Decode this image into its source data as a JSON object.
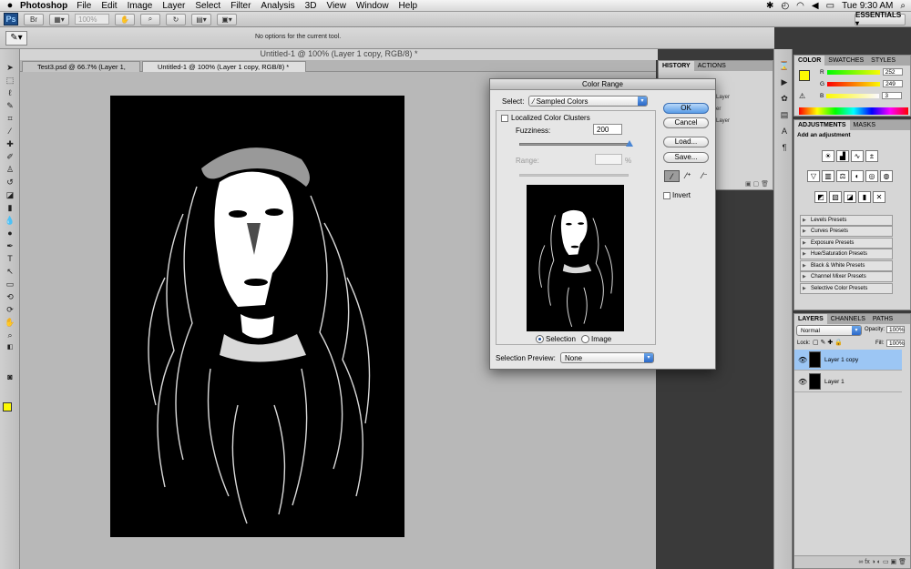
{
  "menubar": {
    "apple": "",
    "app": "Photoshop",
    "items": [
      "File",
      "Edit",
      "Image",
      "Layer",
      "Select",
      "Filter",
      "Analysis",
      "3D",
      "View",
      "Window",
      "Help"
    ],
    "clock": "Tue 9:30 AM"
  },
  "appbar": {
    "ps": "Ps",
    "zoom": "100%",
    "workspace": "ESSENTIALS ▾"
  },
  "options": {
    "message": "No options for the current tool."
  },
  "document": {
    "window_title": "Untitled-1 @ 100% (Layer 1 copy, RGB/8) *",
    "tabs": [
      {
        "label": "Test3.psd @ 66.7% (Layer 1, RGB/8) *"
      },
      {
        "label": "Untitled-1 @ 100% (Layer 1 copy, RGB/8) *"
      }
    ]
  },
  "history": {
    "tabs": [
      "HISTORY",
      "ACTIONS"
    ],
    "items": [
      "",
      "",
      "Layer",
      "er",
      "Layer",
      ""
    ]
  },
  "color_panel": {
    "tabs": [
      "COLOR",
      "SWATCHES",
      "STYLES"
    ],
    "r_label": "R",
    "g_label": "G",
    "b_label": "B",
    "r": "252",
    "g": "249",
    "b": "3",
    "fg": "#fcf903",
    "bg": "#ff9999"
  },
  "adjustments": {
    "tabs": [
      "ADJUSTMENTS",
      "MASKS"
    ],
    "heading": "Add an adjustment",
    "presets": [
      "Levels Presets",
      "Curves Presets",
      "Exposure Presets",
      "Hue/Saturation Presets",
      "Black & White Presets",
      "Channel Mixer Presets",
      "Selective Color Presets"
    ]
  },
  "layers": {
    "tabs": [
      "LAYERS",
      "CHANNELS",
      "PATHS"
    ],
    "blend_mode": "Normal",
    "opacity_label": "Opacity:",
    "opacity": "100%",
    "lock_label": "Lock:",
    "fill_label": "Fill:",
    "fill": "100%",
    "items": [
      "Layer 1 copy",
      "Layer 1"
    ]
  },
  "dialog": {
    "title": "Color Range",
    "select_label": "Select:",
    "select_value": "Sampled Colors",
    "localized": "Localized Color Clusters",
    "fuzziness_label": "Fuzziness:",
    "fuzziness": "200",
    "range_label": "Range:",
    "range_unit": "%",
    "ok": "OK",
    "cancel": "Cancel",
    "load": "Load...",
    "save": "Save...",
    "invert": "Invert",
    "selection": "Selection",
    "image": "Image",
    "preview_label": "Selection Preview:",
    "preview_value": "None"
  }
}
